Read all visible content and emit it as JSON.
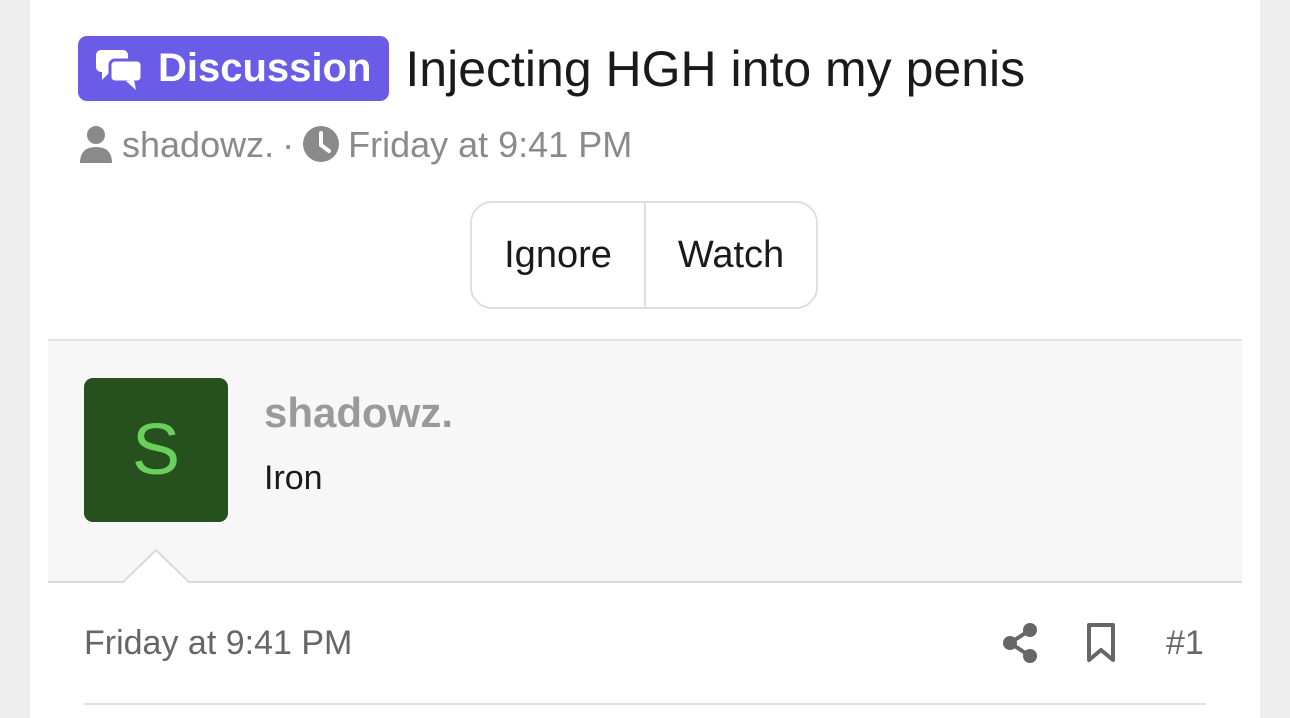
{
  "thread": {
    "prefix": "Discussion",
    "title": "Injecting HGH into my penis",
    "author": "shadowz.",
    "separator": "·",
    "time": "Friday at 9:41 PM"
  },
  "actions": {
    "ignore_label": "Ignore",
    "watch_label": "Watch"
  },
  "post": {
    "avatar_letter": "S",
    "username": "shadowz.",
    "user_title": "Iron",
    "date": "Friday at 9:41 PM",
    "number": "#1"
  },
  "icons": {
    "prefix_icon": "comments-icon",
    "author_icon": "user-icon",
    "time_icon": "clock-icon",
    "share_icon": "share-icon",
    "bookmark_icon": "bookmark-icon"
  },
  "colors": {
    "badge_background": "#6b5ce7",
    "avatar_background": "#27501f",
    "avatar_letter": "#6bcf5c"
  }
}
